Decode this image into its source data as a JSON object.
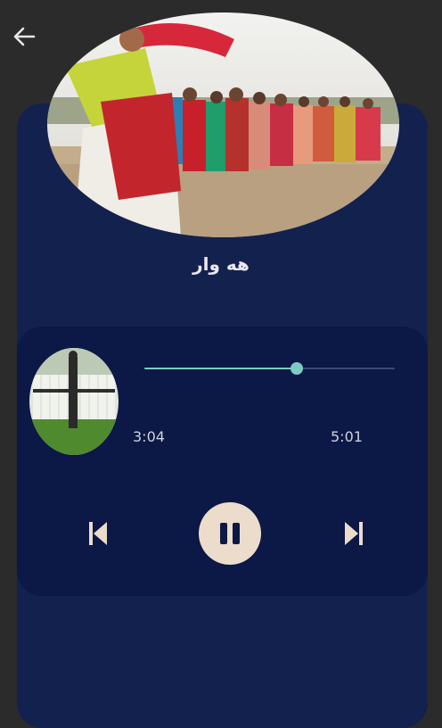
{
  "app": {
    "back_icon": "arrow-left-icon",
    "song_title": "هه وار"
  },
  "player": {
    "current_time": "3:04",
    "total_time": "5:01",
    "progress": 0.61,
    "prev_icon": "skip-previous-icon",
    "pause_icon": "pause-icon",
    "next_icon": "skip-next-icon"
  },
  "colors": {
    "background": "#2b2b2b",
    "card": "#13214f",
    "player_card": "#0c1845",
    "accent": "#7cccc4",
    "control": "#ecdccb"
  }
}
